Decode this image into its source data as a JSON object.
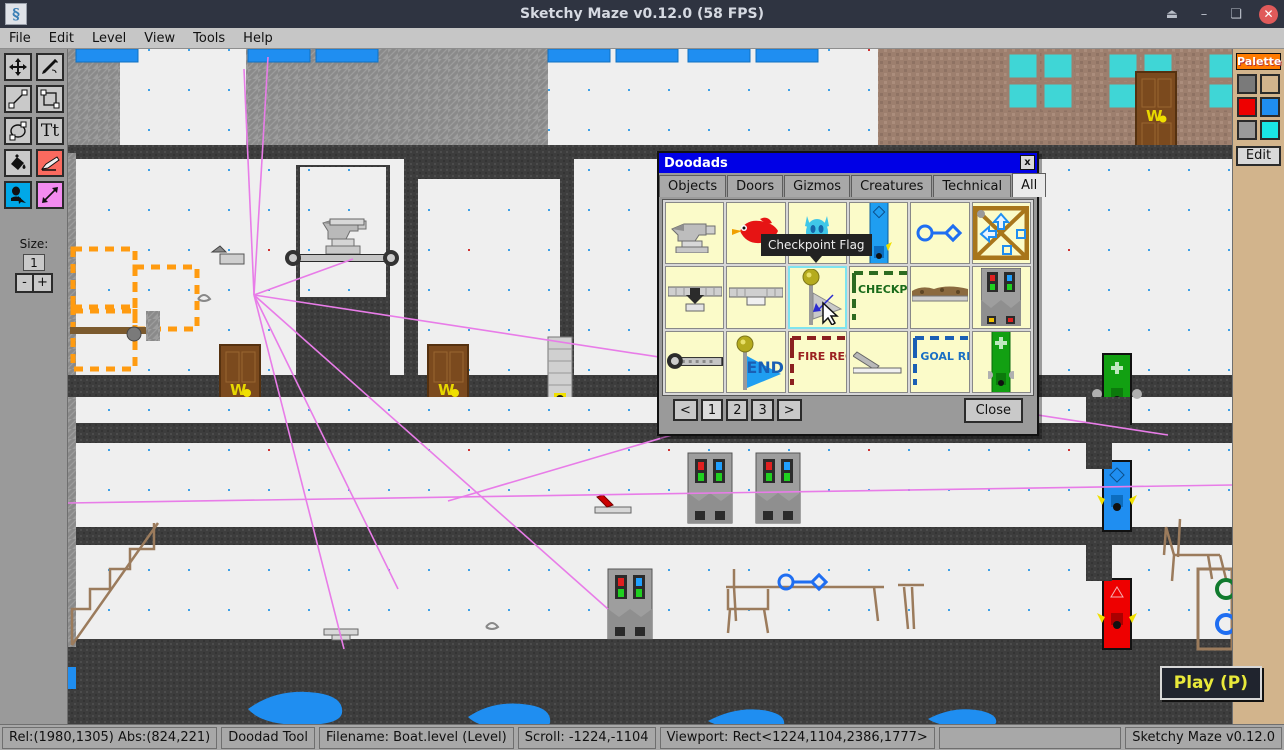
{
  "window": {
    "title": "Sketchy Maze v0.12.0 (58 FPS)",
    "app_icon": "§",
    "controls": [
      {
        "name": "eject",
        "glyph": "⏏"
      },
      {
        "name": "minimize",
        "glyph": "–"
      },
      {
        "name": "maximize",
        "glyph": "❏"
      },
      {
        "name": "close",
        "glyph": "✕"
      }
    ]
  },
  "menubar": {
    "items": [
      "File",
      "Edit",
      "Level",
      "View",
      "Tools",
      "Help"
    ]
  },
  "toolbar": {
    "tools": [
      {
        "name": "pan-tool",
        "icon": "move-icon",
        "selected": false
      },
      {
        "name": "pencil-tool",
        "icon": "pencil-icon",
        "selected": false
      },
      {
        "name": "line-tool",
        "icon": "line-icon",
        "selected": false
      },
      {
        "name": "rectangle-tool",
        "icon": "rectangle-icon",
        "selected": false
      },
      {
        "name": "ellipse-tool",
        "icon": "ellipse-icon",
        "selected": false
      },
      {
        "name": "text-tool",
        "icon": "text-icon",
        "label": "Tt",
        "selected": false
      },
      {
        "name": "fill-tool",
        "icon": "paint-bucket-icon",
        "selected": false
      },
      {
        "name": "eraser-tool",
        "icon": "eraser-icon",
        "selected": false
      },
      {
        "name": "doodad-tool",
        "icon": "doodad-icon",
        "selected": true
      },
      {
        "name": "link-tool",
        "icon": "link-arrow-icon",
        "selected": false
      }
    ],
    "size_label": "Size:",
    "size_value": "1",
    "decrease_label": "-",
    "increase_label": "+"
  },
  "palette": {
    "header": "Palette",
    "edit_label": "Edit",
    "swatches": [
      {
        "name": "solid-gray",
        "color": "#7a7a7a"
      },
      {
        "name": "tan",
        "color": "#d2b48c"
      },
      {
        "name": "red",
        "color": "#ee0000"
      },
      {
        "name": "blue",
        "color": "#1f8ef1"
      },
      {
        "name": "gray",
        "color": "#9a9a9a"
      },
      {
        "name": "cyan",
        "color": "#19e6e6"
      }
    ]
  },
  "play_button": {
    "label": "Play (P)"
  },
  "doodads_dialog": {
    "title": "Doodads",
    "close_glyph": "x",
    "tabs": [
      {
        "label": "Objects",
        "active": false
      },
      {
        "label": "Doors",
        "active": false
      },
      {
        "label": "Gizmos",
        "active": false
      },
      {
        "label": "Creatures",
        "active": false
      },
      {
        "label": "Technical",
        "active": false
      },
      {
        "label": "All",
        "active": true
      }
    ],
    "items": [
      {
        "name": "anvil",
        "type": "anvil",
        "selected": false
      },
      {
        "name": "red-bird",
        "type": "bird",
        "selected": false
      },
      {
        "name": "blue-azulian",
        "type": "azulian",
        "selected": false
      },
      {
        "name": "blue-door",
        "type": "door-blue",
        "selected": false
      },
      {
        "name": "blue-key",
        "type": "key-blue",
        "selected": false
      },
      {
        "name": "box",
        "type": "box",
        "selected": false
      },
      {
        "name": "crumbly-floor",
        "type": "crumbly-floor",
        "selected": false
      },
      {
        "name": "thin-platform",
        "type": "thin-platform",
        "selected": false
      },
      {
        "name": "checkpoint-flag",
        "type": "flag-gray",
        "selected": true
      },
      {
        "name": "checkpoint-region",
        "type": "region-green",
        "label": "CHECKPOINT",
        "selected": false
      },
      {
        "name": "dirt-shelf",
        "type": "dirt-shelf",
        "selected": false
      },
      {
        "name": "electric-door",
        "type": "electric-door",
        "selected": false
      },
      {
        "name": "conveyor-belt",
        "type": "conveyor",
        "selected": false
      },
      {
        "name": "exit-flag",
        "type": "flag-blue",
        "label": "END",
        "selected": false
      },
      {
        "name": "fire-region",
        "type": "region-red",
        "label": "FIRE REGION",
        "selected": false
      },
      {
        "name": "small-ramp",
        "type": "ramp",
        "selected": false
      },
      {
        "name": "goal-region",
        "type": "region-blue",
        "label": "GOAL REGION",
        "selected": false
      },
      {
        "name": "green-door",
        "type": "door-green",
        "selected": false
      }
    ],
    "pager": {
      "prev": "<",
      "pages": [
        "1",
        "2",
        "3"
      ],
      "current": "1",
      "next": ">"
    },
    "close_label": "Close"
  },
  "tooltip": {
    "text": "Checkpoint Flag"
  },
  "statusbar": {
    "cells": [
      {
        "name": "cursor-coords",
        "text": "Rel:(1980,1305)  Abs:(824,221)"
      },
      {
        "name": "active-tool",
        "text": "Doodad Tool"
      },
      {
        "name": "filename",
        "text": "Filename: Boat.level (Level)"
      },
      {
        "name": "scroll",
        "text": "Scroll: -1224,-1104"
      },
      {
        "name": "viewport",
        "text": "Viewport: Rect<1224,1104,2386,1777>"
      }
    ],
    "version": "Sketchy Maze v0.12.0"
  }
}
